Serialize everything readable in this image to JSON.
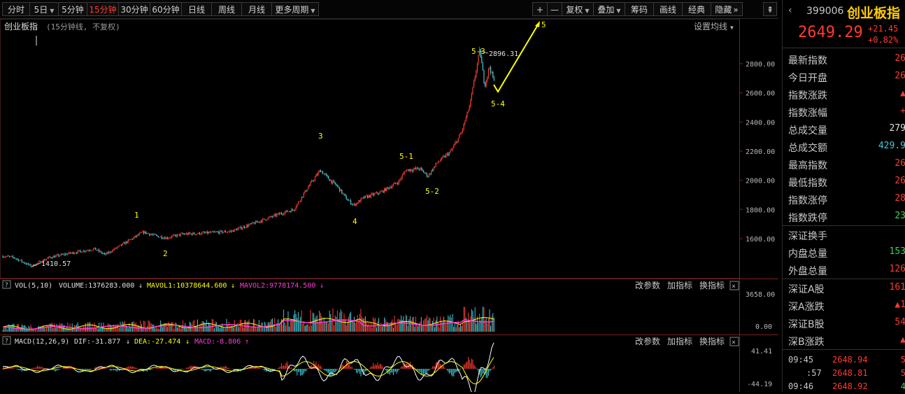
{
  "toolbar": {
    "items": [
      {
        "label": "分时",
        "active": false,
        "dropdown": false
      },
      {
        "label": "5日",
        "active": false,
        "dropdown": true
      },
      {
        "label": "5分钟",
        "active": false,
        "dropdown": false
      },
      {
        "label": "15分钟",
        "active": true,
        "dropdown": false
      },
      {
        "label": "30分钟",
        "active": false,
        "dropdown": false
      },
      {
        "label": "60分钟",
        "active": false,
        "dropdown": false
      },
      {
        "label": "日线",
        "active": false,
        "dropdown": false
      },
      {
        "label": "周线",
        "active": false,
        "dropdown": false
      },
      {
        "label": "月线",
        "active": false,
        "dropdown": false
      },
      {
        "label": "更多周期",
        "active": false,
        "dropdown": true
      }
    ],
    "right_items": [
      {
        "label": "+",
        "dropdown": false
      },
      {
        "label": "—",
        "dropdown": false
      },
      {
        "label": "复权",
        "dropdown": true
      },
      {
        "label": "叠加",
        "dropdown": true
      },
      {
        "label": "筹码",
        "dropdown": false
      },
      {
        "label": "画线",
        "dropdown": false
      },
      {
        "label": "经典",
        "dropdown": false
      },
      {
        "label": "隐藏",
        "dropdown": false
      }
    ],
    "expand_symbol": "⇞",
    "hide_arrows": "»"
  },
  "main_chart": {
    "index_name": "创业板指",
    "period_label": "(15分钟线, 不复权)",
    "ma_settings": "设置均线",
    "y_ticks": [
      "2800.00",
      "2600.00",
      "2400.00",
      "2200.00",
      "2000.00",
      "1800.00",
      "1600.00"
    ],
    "low_label": "1410.57",
    "high_label": "2896.31",
    "wave_labels": [
      "1",
      "2",
      "3",
      "4",
      "5-1",
      "5-2",
      "5-3",
      "5-4",
      "5"
    ],
    "price_color_up": "#ff3b30",
    "price_color_down": "#3ecbd6",
    "annotation_color": "#ffff00"
  },
  "volume_panel": {
    "title": "VOL(5,10)",
    "volume_text": "VOLUME:1376283.000",
    "mavol1_text": "MAVOL1:10378644.600",
    "mavol2_text": "MAVOL2:9778174.500",
    "y_ticks": [
      "3658.00",
      "0.00"
    ],
    "buttons": [
      "改参数",
      "加指标",
      "换指标"
    ]
  },
  "macd_panel": {
    "title": "MACD(12,26,9)",
    "dif_text": "DIF:-31.877",
    "dea_text": "DEA:-27.474",
    "macd_text": "MACD:-8.806",
    "y_ticks": [
      "41.41",
      "-44.19"
    ],
    "buttons": [
      "改参数",
      "加指标",
      "换指标"
    ]
  },
  "right_panel": {
    "back_icon": "‹",
    "code": "399006",
    "name": "创业板指",
    "price": "2649.29",
    "change": "+21.45",
    "change_pct": "+0.82%",
    "rows": [
      {
        "label": "最新指数",
        "value": "26",
        "color": "#ff3b30"
      },
      {
        "label": "今日开盘",
        "value": "26",
        "color": "#ff3b30"
      },
      {
        "label": "指数涨跌",
        "value": "▲",
        "color": "#ff3b30"
      },
      {
        "label": "指数涨幅",
        "value": "+",
        "color": "#ff3b30"
      },
      {
        "label": "总成交量",
        "value": "279",
        "color": "#e0e0e0"
      },
      {
        "label": "总成交额",
        "value": "429.9",
        "color": "#3ecbd6"
      },
      {
        "label": "最高指数",
        "value": "26",
        "color": "#ff3b30"
      },
      {
        "label": "最低指数",
        "value": "26",
        "color": "#ff3b30"
      },
      {
        "label": "指数涨停",
        "value": "28",
        "color": "#ff3b30"
      },
      {
        "label": "指数跌停",
        "value": "23",
        "color": "#39d353"
      },
      {
        "label": "深证换手",
        "value": "",
        "color": "#e0e0e0"
      },
      {
        "label": "内盘总量",
        "value": "153",
        "color": "#39d353"
      },
      {
        "label": "外盘总量",
        "value": "126",
        "color": "#ff3b30"
      },
      {
        "label": "深证A股",
        "value": "161",
        "color": "#ff3b30"
      },
      {
        "label": "深A涨跌",
        "value": "▲1",
        "color": "#ff3b30"
      },
      {
        "label": "深证B股",
        "value": "54",
        "color": "#ff3b30"
      },
      {
        "label": "深B涨跌",
        "value": "▲",
        "color": "#ff3b30"
      }
    ],
    "ticks": [
      {
        "time": "09:45",
        "price": "2648.94",
        "vol": "5"
      },
      {
        "time": ":57",
        "price": "2648.81",
        "vol": "5"
      },
      {
        "time": "09:46",
        "price": "2648.92",
        "vol": "4"
      }
    ]
  }
}
